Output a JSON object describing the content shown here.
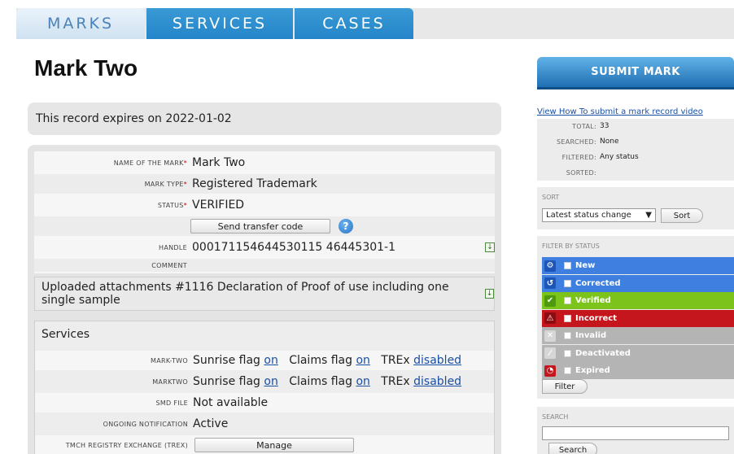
{
  "tabs": [
    {
      "label": "MARKS"
    },
    {
      "label": "SERVICES"
    },
    {
      "label": "CASES"
    }
  ],
  "page_title": "Mark Two",
  "expiry_text": "This record expires on 2022-01-02",
  "form": {
    "name_label": "NAME OF THE MARK",
    "name_value": "Mark Two",
    "type_label": "MARK TYPE",
    "type_value": "Registered Trademark",
    "status_label": "STATUS",
    "status_value": "VERIFIED",
    "transfer_button": "Send transfer code",
    "help_glyph": "?",
    "handle_label": "HANDLE",
    "handle_value": "000171154644530115 46445301-1",
    "comment_label": "COMMENT",
    "required_mark": "*"
  },
  "attachments_text": "Uploaded attachments #1116 Declaration of Proof of use including one single sample",
  "services": {
    "title": "Services",
    "rows": [
      {
        "label": "MARK-TWO",
        "sunrise": "Sunrise flag",
        "sunrise_link": "on",
        "claims": "Claims flag",
        "claims_link": "on",
        "trex": "TREx",
        "trex_link": "disabled"
      },
      {
        "label": "MARKTWO",
        "sunrise": "Sunrise flag",
        "sunrise_link": "on",
        "claims": "Claims flag",
        "claims_link": "on",
        "trex": "TREx",
        "trex_link": "disabled"
      }
    ],
    "smd_label": "SMD FILE",
    "smd_value": "Not available",
    "notification_label": "ONGOING NOTIFICATION",
    "notification_value": "Active",
    "trex_label": "TMCH REGISTRY EXCHANGE (TREX)",
    "manage_button": "Manage"
  },
  "sidebar": {
    "submit_button": "SUBMIT MARK",
    "video_link": "View How To submit a mark record video",
    "stats": [
      {
        "key": "TOTAL:",
        "value": "33"
      },
      {
        "key": "SEARCHED:",
        "value": "None"
      },
      {
        "key": "FILTERED:",
        "value": "Any status"
      },
      {
        "key": "SORTED:",
        "value": ""
      }
    ],
    "sort_heading": "SORT",
    "sort_selected": "Latest status change",
    "sort_button": "Sort",
    "filter_heading": "FILTER BY STATUS",
    "statuses": [
      {
        "label": "New",
        "bg": "#3f7fe0",
        "icon_bg": "#1e56b8",
        "glyph": "⚙"
      },
      {
        "label": "Corrected",
        "bg": "#3f7fe0",
        "icon_bg": "#1e56b8",
        "glyph": "↺"
      },
      {
        "label": "Verified",
        "bg": "#7cc41c",
        "icon_bg": "#4e9a0c",
        "glyph": "✔"
      },
      {
        "label": "Incorrect",
        "bg": "#c4161c",
        "icon_bg": "#8e0c10",
        "glyph": "⚠"
      },
      {
        "label": "Invalid",
        "bg": "#b4b4b4",
        "icon_bg": "#d6d6d6",
        "glyph": "✕"
      },
      {
        "label": "Deactivated",
        "bg": "#b4b4b4",
        "icon_bg": "#d6d6d6",
        "glyph": "⁄"
      },
      {
        "label": "Expired",
        "bg": "#b4b4b4",
        "icon_bg": "#c4161c",
        "glyph": "◔"
      }
    ],
    "filter_button": "Filter",
    "search_heading": "SEARCH",
    "search_value": "",
    "search_button": "Search"
  }
}
